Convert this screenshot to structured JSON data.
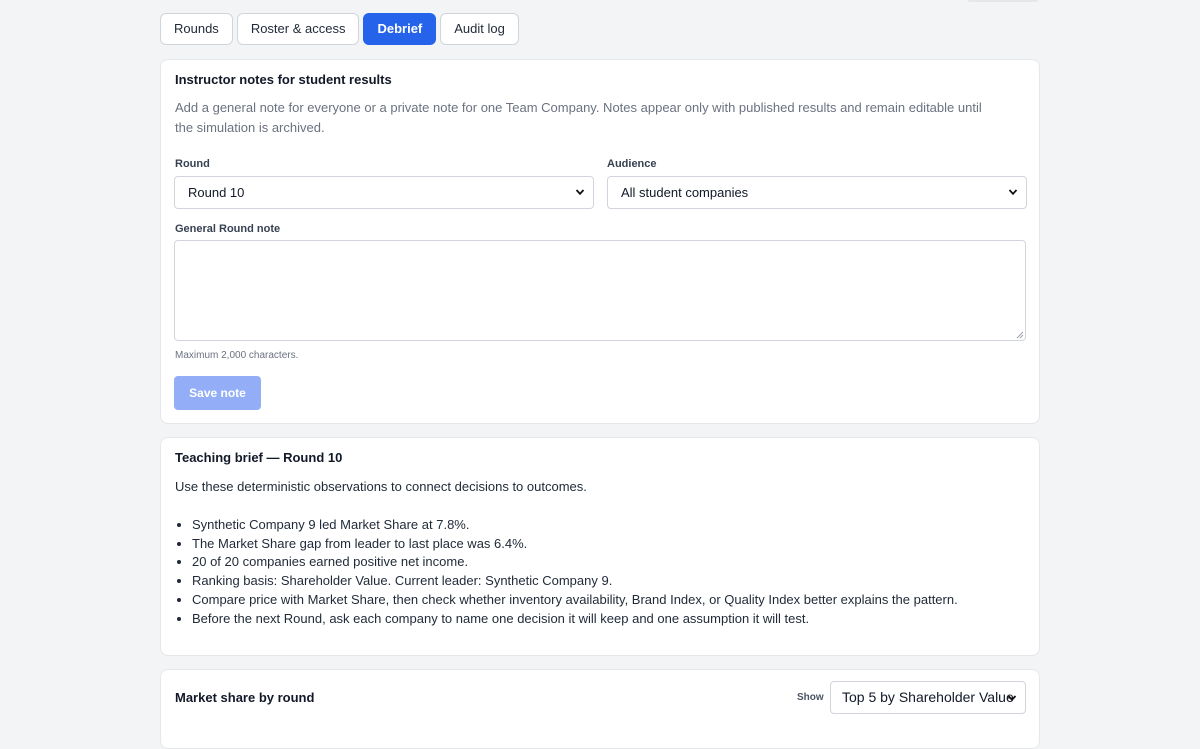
{
  "tabs": [
    {
      "label": "Rounds",
      "active": false
    },
    {
      "label": "Roster & access",
      "active": false
    },
    {
      "label": "Debrief",
      "active": true
    },
    {
      "label": "Audit log",
      "active": false
    }
  ],
  "notes": {
    "title": "Instructor notes for student results",
    "description": "Add a general note for everyone or a private note for one Team Company. Notes appear only with published results and remain editable until the simulation is archived.",
    "round_label": "Round",
    "round_value": "Round 10",
    "audience_label": "Audience",
    "audience_value": "All student companies",
    "note_label": "General Round note",
    "note_value": "",
    "hint": "Maximum 2,000 characters.",
    "save_label": "Save note"
  },
  "brief": {
    "title": "Teaching brief — Round 10",
    "intro": "Use these deterministic observations to connect decisions to outcomes.",
    "items": [
      "Synthetic Company 9 led Market Share at 7.8%.",
      "The Market Share gap from leader to last place was 6.4%.",
      "20 of 20 companies earned positive net income.",
      "Ranking basis: Shareholder Value. Current leader: Synthetic Company 9.",
      "Compare price with Market Share, then check whether inventory availability, Brand Index, or Quality Index better explains the pattern.",
      "Before the next Round, ask each company to name one decision it will keep and one assumption it will test."
    ]
  },
  "market": {
    "title": "Market share by round",
    "show_label": "Show",
    "show_value": "Top 5 by Shareholder Value"
  },
  "colors": {
    "accent": "#2563eb",
    "save_disabled": "#93aef7",
    "page_bg": "#f3f4f6"
  }
}
